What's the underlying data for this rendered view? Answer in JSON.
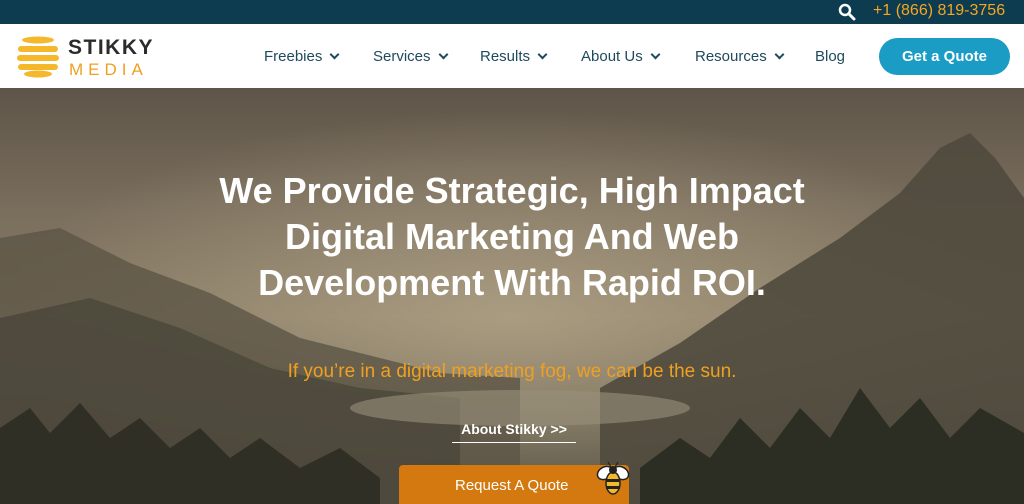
{
  "topbar": {
    "search_icon": "search-icon",
    "phone": "+1 (866) 819-3756"
  },
  "logo": {
    "word1": "STIKKY",
    "word2": "MEDIA"
  },
  "nav": {
    "items": [
      {
        "label": "Freebies",
        "dropdown": true
      },
      {
        "label": "Services",
        "dropdown": true
      },
      {
        "label": "Results",
        "dropdown": true
      },
      {
        "label": "About Us",
        "dropdown": true
      },
      {
        "label": "Resources",
        "dropdown": true
      },
      {
        "label": "Blog",
        "dropdown": false
      }
    ],
    "cta_label": "Get a Quote"
  },
  "hero": {
    "headline": "We Provide Strategic, High Impact Digital Marketing And Web Development With Rapid ROI.",
    "subheadline": "If you’re in a digital marketing fog, we can be the sun.",
    "about_link": "About Stikky >>",
    "quote_button": "Request A Quote"
  },
  "colors": {
    "topbar": "#0d3b4f",
    "accent_orange": "#f0a020",
    "cta_blue": "#1a9cc4",
    "quote_button": "#d4790f",
    "nav_text": "#1f4a5c"
  }
}
